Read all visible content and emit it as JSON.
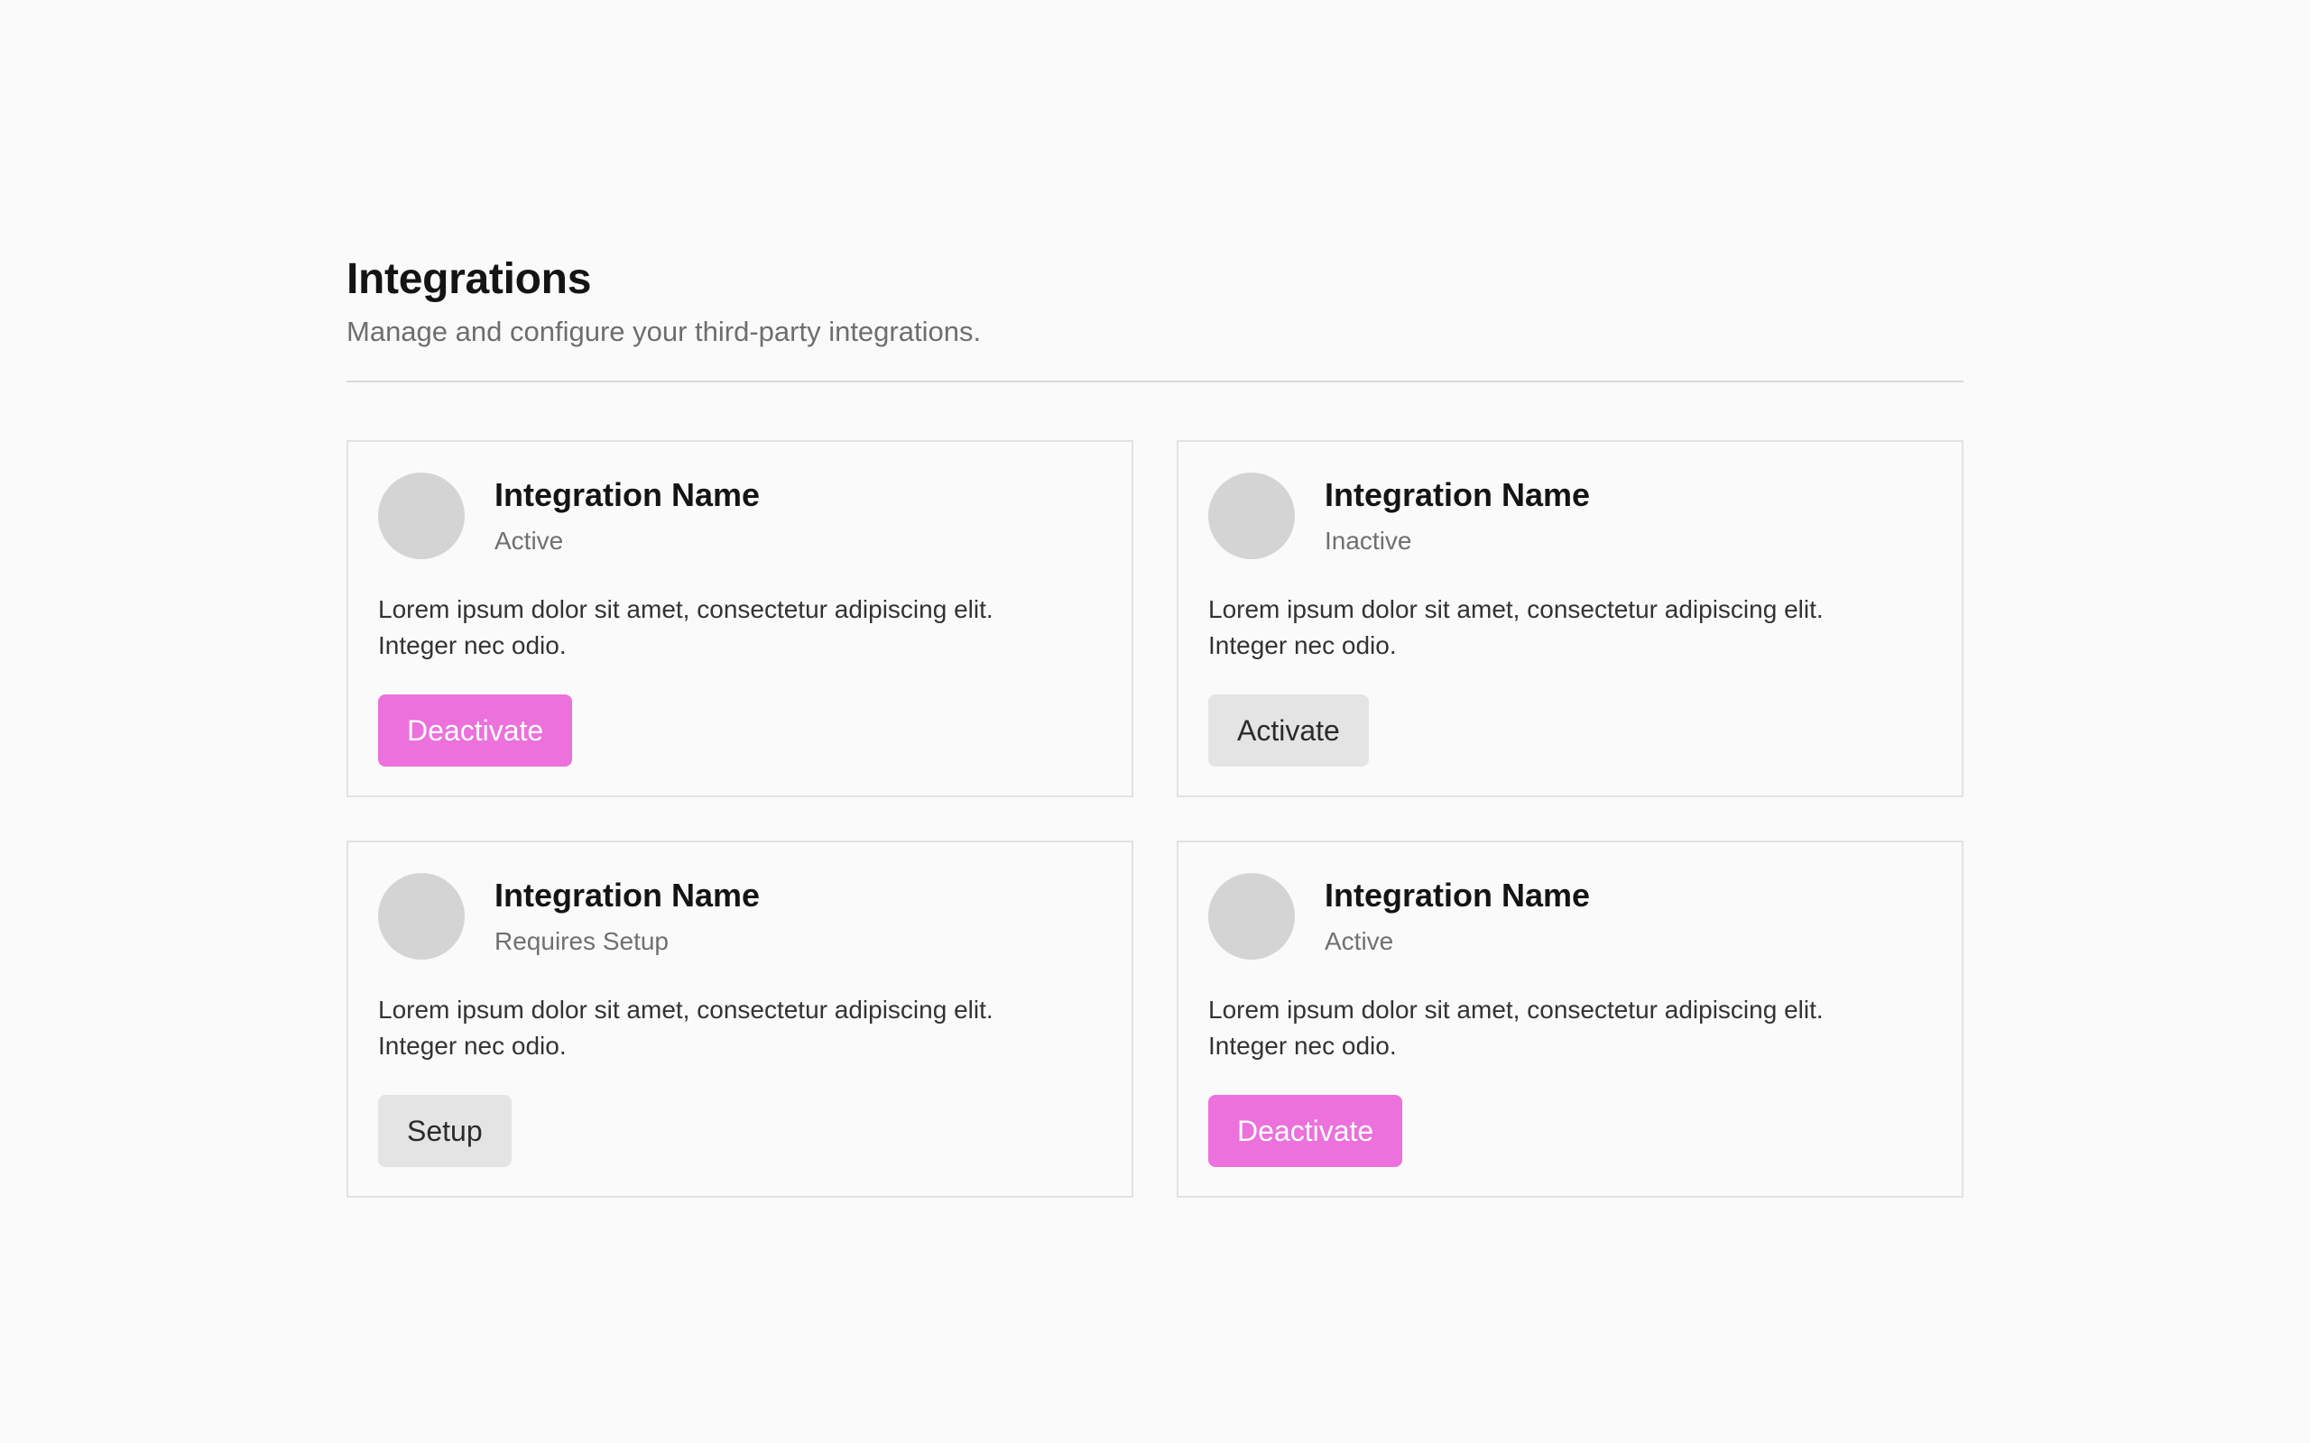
{
  "header": {
    "title": "Integrations",
    "subtitle": "Manage and configure your third-party integrations."
  },
  "integrations": [
    {
      "name": "Integration Name",
      "status": "Active",
      "description": "Lorem ipsum dolor sit amet, consectetur adipiscing elit. Integer nec odio.",
      "action_label": "Deactivate",
      "action_style": "primary"
    },
    {
      "name": "Integration Name",
      "status": "Inactive",
      "description": "Lorem ipsum dolor sit amet, consectetur adipiscing elit. Integer nec odio.",
      "action_label": "Activate",
      "action_style": "secondary"
    },
    {
      "name": "Integration Name",
      "status": "Requires Setup",
      "description": "Lorem ipsum dolor sit amet, consectetur adipiscing elit. Integer nec odio.",
      "action_label": "Setup",
      "action_style": "secondary"
    },
    {
      "name": "Integration Name",
      "status": "Active",
      "description": "Lorem ipsum dolor sit amet, consectetur adipiscing elit. Integer nec odio.",
      "action_label": "Deactivate",
      "action_style": "primary"
    }
  ],
  "colors": {
    "accent": "#ec71dc",
    "secondary_button": "#e4e4e4",
    "avatar_placeholder": "#d4d4d4",
    "background": "#fafafa"
  }
}
